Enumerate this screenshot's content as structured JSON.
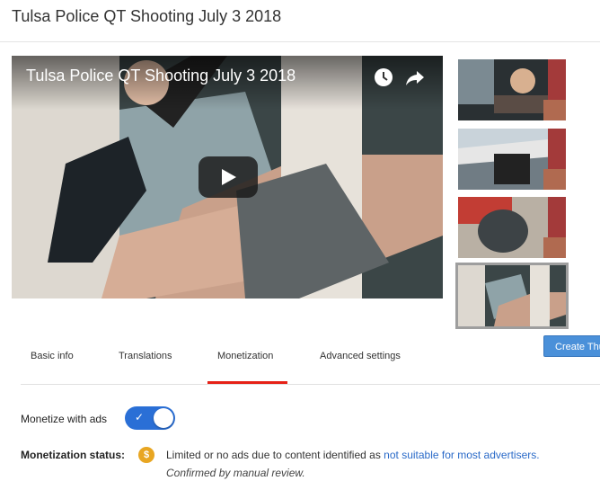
{
  "page": {
    "title": "Tulsa Police QT Shooting July 3 2018"
  },
  "player": {
    "title": "Tulsa Police QT Shooting July 3 2018",
    "icons": [
      "watch-later-icon",
      "share-icon",
      "play-icon"
    ]
  },
  "thumbnails": [
    {
      "name": "thumbnail-option-1",
      "selected": false
    },
    {
      "name": "thumbnail-option-2",
      "selected": false
    },
    {
      "name": "thumbnail-option-3",
      "selected": false
    },
    {
      "name": "thumbnail-option-4",
      "selected": true
    }
  ],
  "create_thumbnail_button": "Create Thu",
  "tabs": [
    {
      "label": "Basic info",
      "active": false
    },
    {
      "label": "Translations",
      "active": false
    },
    {
      "label": "Monetization",
      "active": true
    },
    {
      "label": "Advanced settings",
      "active": false
    }
  ],
  "monetize": {
    "label": "Monetize with ads",
    "enabled": true
  },
  "status": {
    "label": "Monetization status:",
    "text": "Limited or no ads due to content identified as",
    "link": "not suitable for most advertisers.",
    "note": "Confirmed by manual review."
  },
  "colors": {
    "accent": "#e62117",
    "toggle": "#2a6fd6",
    "link": "#2a6ac8",
    "warning": "#e8a622"
  }
}
